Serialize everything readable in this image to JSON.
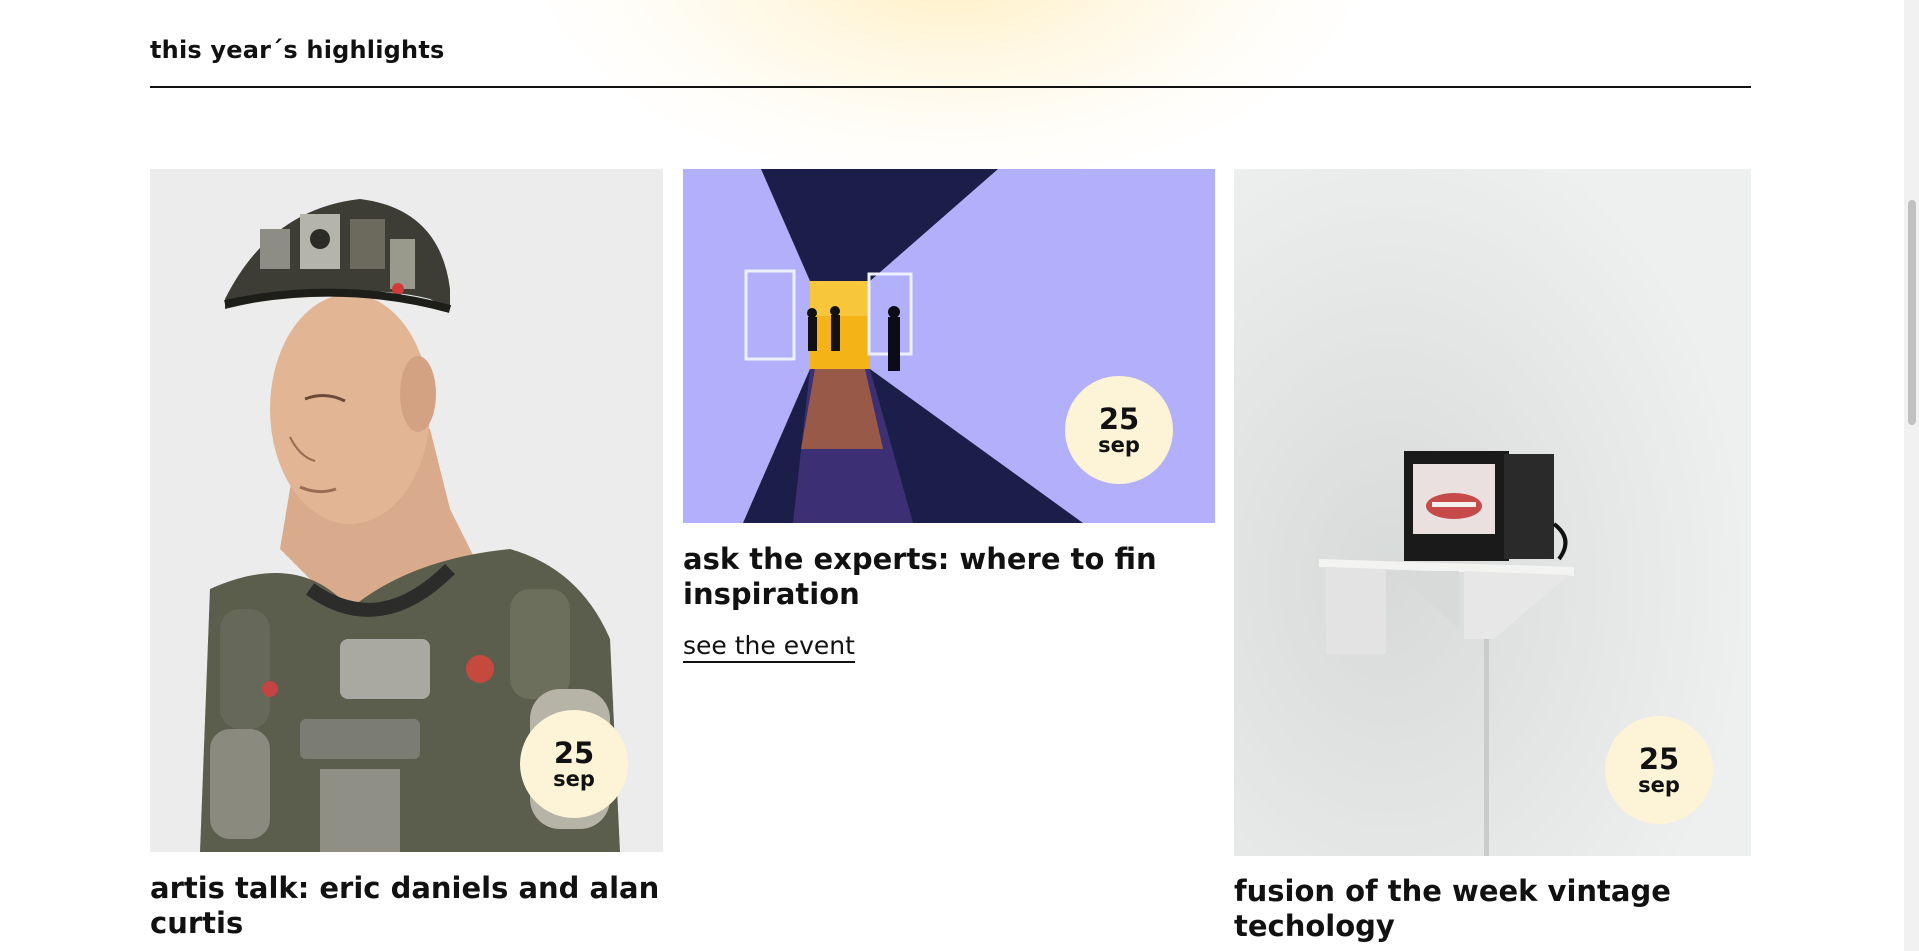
{
  "section": {
    "title": "this year´s highlights"
  },
  "cards": [
    {
      "title": "artis talk: eric daniels and alan curtis",
      "date_day": "25",
      "date_month": "sep",
      "image_subject": "humanoid robot"
    },
    {
      "title": "ask the experts: where to fin inspiration",
      "date_day": "25",
      "date_month": "sep",
      "link_label": "see the event",
      "image_subject": "people in illuminated corridor"
    },
    {
      "title": "fusion of the week vintage techology",
      "date_day": "25",
      "date_month": "sep",
      "image_subject": "small tv on wall shelf"
    }
  ],
  "colors": {
    "badge": "#fdf3d6",
    "accent_violet": "#b3b0fb",
    "text": "#111111"
  }
}
